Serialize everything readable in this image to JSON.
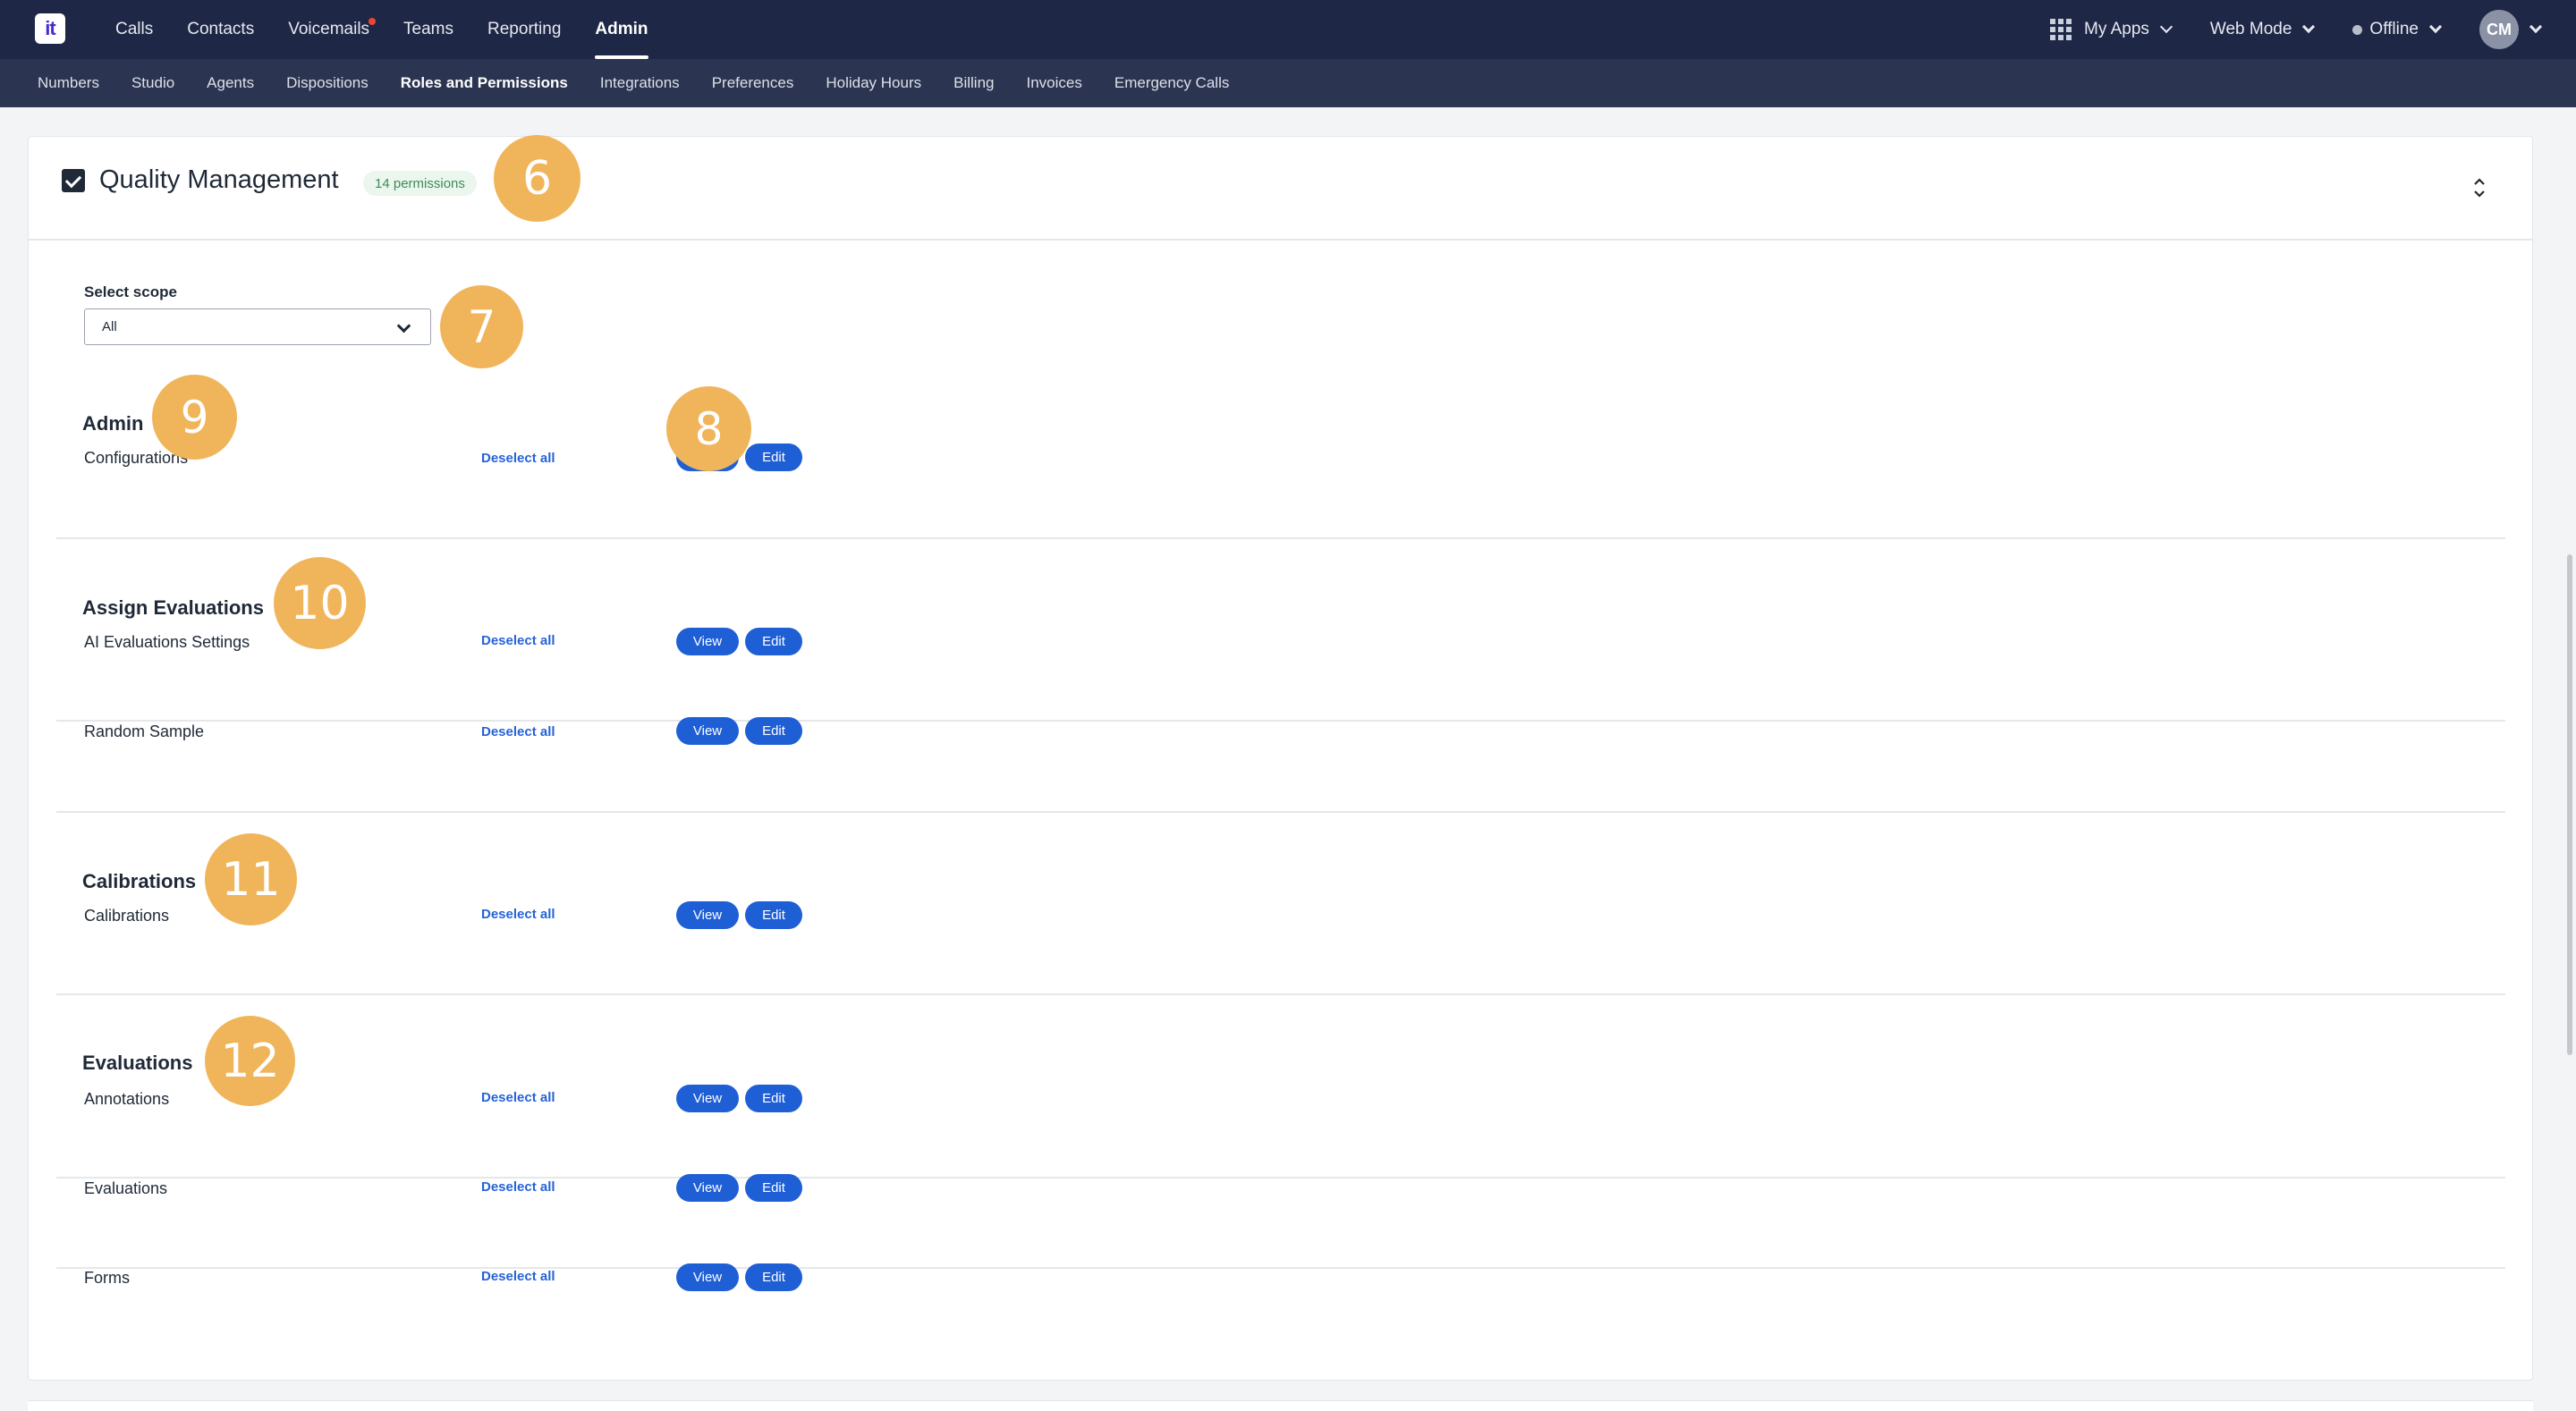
{
  "logo": {
    "text": "it"
  },
  "main_nav": [
    {
      "label": "Calls",
      "active": false,
      "dot": false
    },
    {
      "label": "Contacts",
      "active": false,
      "dot": false
    },
    {
      "label": "Voicemails",
      "active": false,
      "dot": true
    },
    {
      "label": "Teams",
      "active": false,
      "dot": false
    },
    {
      "label": "Reporting",
      "active": false,
      "dot": false
    },
    {
      "label": "Admin",
      "active": true,
      "dot": false
    }
  ],
  "right_nav": {
    "apps_label": "My Apps",
    "mode_label": "Web Mode",
    "status_label": "Offline",
    "avatar_initials": "CM"
  },
  "sub_nav": [
    {
      "label": "Numbers",
      "active": false
    },
    {
      "label": "Studio",
      "active": false
    },
    {
      "label": "Agents",
      "active": false
    },
    {
      "label": "Dispositions",
      "active": false
    },
    {
      "label": "Roles and Permissions",
      "active": true
    },
    {
      "label": "Integrations",
      "active": false
    },
    {
      "label": "Preferences",
      "active": false
    },
    {
      "label": "Holiday Hours",
      "active": false
    },
    {
      "label": "Billing",
      "active": false
    },
    {
      "label": "Invoices",
      "active": false
    },
    {
      "label": "Emergency Calls",
      "active": false
    }
  ],
  "card": {
    "title": "Quality Management",
    "badge": "14 permissions",
    "scope_label": "Select scope",
    "scope_value": "All"
  },
  "sections": {
    "admin": "Admin",
    "assign": "Assign Evaluations",
    "calibrations": "Calibrations",
    "evaluations": "Evaluations"
  },
  "rows": [
    {
      "label": "Configurations",
      "deselect": "Deselect all",
      "view": "View",
      "edit": "Edit"
    },
    {
      "label": "AI Evaluations Settings",
      "deselect": "Deselect all",
      "view": "View",
      "edit": "Edit"
    },
    {
      "label": "Random Sample",
      "deselect": "Deselect all",
      "view": "View",
      "edit": "Edit"
    },
    {
      "label": "Calibrations",
      "deselect": "Deselect all",
      "view": "View",
      "edit": "Edit"
    },
    {
      "label": "Annotations",
      "deselect": "Deselect all",
      "view": "View",
      "edit": "Edit"
    },
    {
      "label": "Evaluations",
      "deselect": "Deselect all",
      "view": "View",
      "edit": "Edit"
    },
    {
      "label": "Forms",
      "deselect": "Deselect all",
      "view": "View",
      "edit": "Edit"
    }
  ],
  "markers": [
    "6",
    "7",
    "8",
    "9",
    "10",
    "11",
    "12"
  ],
  "colors": {
    "topbar": "#1e2745",
    "subnav": "#2b3450",
    "button": "#1f5fd6",
    "link": "#2563d8",
    "marker": "#f0b55a",
    "badge_bg": "#eaf6ee",
    "badge_text": "#3f8c57"
  }
}
